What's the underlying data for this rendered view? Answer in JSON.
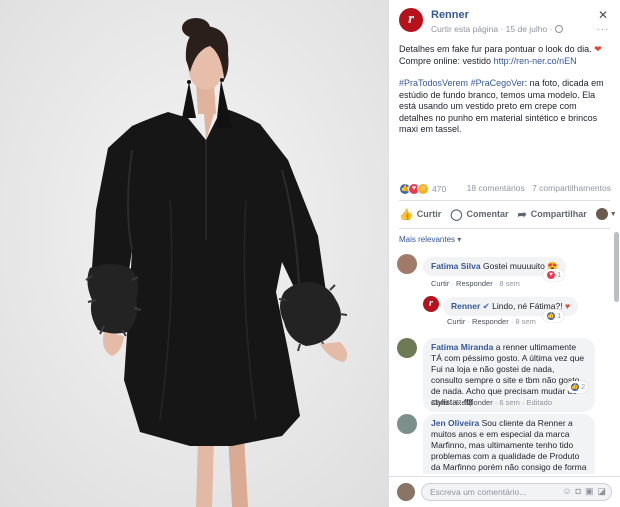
{
  "post": {
    "page_name": "Renner",
    "logo_letter": "r",
    "like_page": "Curtir esta página",
    "meta_sep": " · ",
    "date": "15 de julho",
    "text_line1": "Detalhes em fake fur para pontuar o look do dia.",
    "heart": "❤",
    "text_line2_prefix": "Compre online: vestido ",
    "link": "http://ren-ner.co/nEN",
    "hashtag1": "#PraTodosVerem",
    "hashtag_sep": " ",
    "hashtag2": "#PraCegoVer",
    "description": ": na foto, dicada em estúdio de fundo branco, temos uma modelo. Ela está usando um vestido preto em crepe com detalhes no punho em material sintético e brincos maxi em tassel."
  },
  "stats": {
    "reaction_count": "470",
    "comments": "18 comentários",
    "shares": "7 compartilhamentos"
  },
  "actions": {
    "like": "Curtir",
    "comment": "Comentar",
    "share": "Compartilhar"
  },
  "sort_label": "Mais relevantes",
  "comments": [
    {
      "author": "Fatima Silva",
      "text": "Gostei muuuuito",
      "links": [
        "Curtir",
        "Responder",
        "8 sem"
      ],
      "badge": "1"
    },
    {
      "author": "Renner",
      "text": "Lindo, né Fátima?!",
      "links": [
        "Curtir",
        "Responder",
        "8 sem"
      ],
      "badge": "1"
    },
    {
      "author": "Fatima Miranda",
      "text": "a renner ultimamente TÁ com péssimo gosto. A última vez que Fui na loja e não gostei de nada, consulto sempre o site e tbm não gosto de nada. Acho que precisam mudar de stylista...ffff",
      "links": [
        "Curtir",
        "Responder",
        "6 sem",
        "Editado"
      ],
      "badge": "2"
    },
    {
      "author": "Jen Oliveira",
      "text": "Sou cliente da Renner a muitos anos e em especial da marca Marfinno, mas ultimamente tenho tido problemas com a qualidade de Produto da Marfinno porém não consigo de forma alguma fazer a minha reclamação. O único",
      "links": [],
      "badge": ""
    }
  ],
  "composer": {
    "placeholder": "Escreva um comentário..."
  },
  "colors": {
    "link": "#365899",
    "brand": "#b5121b",
    "like": "#4267b2",
    "love": "#f0354f",
    "haha": "#f7b125"
  }
}
